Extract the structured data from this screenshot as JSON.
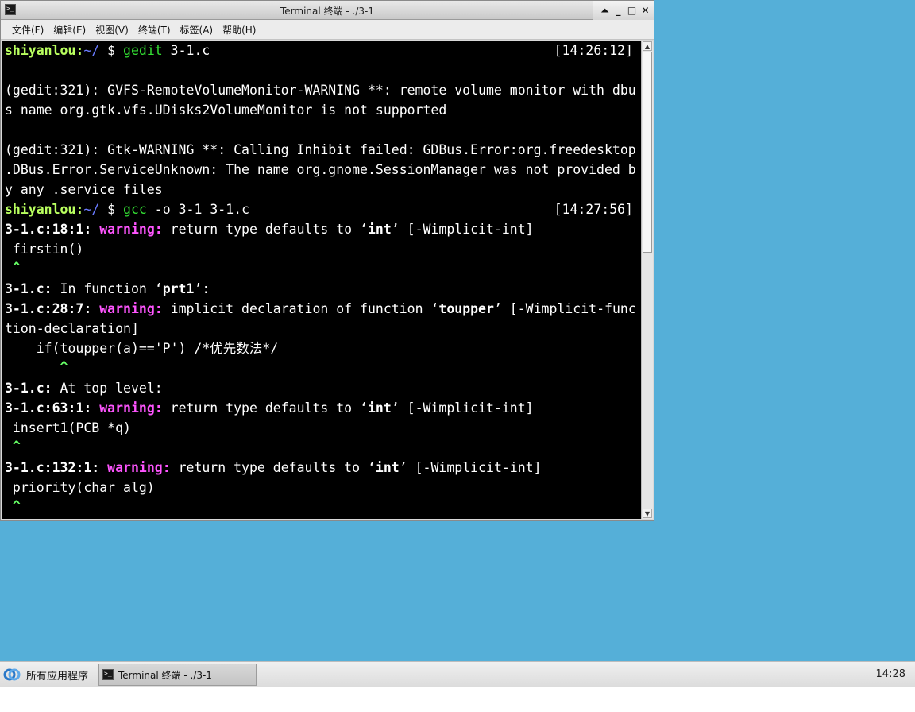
{
  "window": {
    "title": "Terminal 终端 - ./3-1",
    "controls": {
      "shade": "⏶",
      "minimize": "_",
      "maximize": "□",
      "close": "✕"
    }
  },
  "menu": {
    "items": [
      "文件(F)",
      "编辑(E)",
      "视图(V)",
      "终端(T)",
      "标签(A)",
      "帮助(H)"
    ]
  },
  "terminal": {
    "prompt_user": "shiyanlou",
    "prompt_sep": ":",
    "prompt_path": "~/",
    "prompt_dollar": " $ ",
    "cmd1_program": "gedit",
    "cmd1_args": " 3-1.c",
    "cmd1_time": "[14:26:12]",
    "gvfs_line1": "(gedit:321): GVFS-RemoteVolumeMonitor-WARNING **: remote volume monitor with dbu",
    "gvfs_line2": "s name org.gtk.vfs.UDisks2VolumeMonitor is not supported",
    "gtk_line1": "(gedit:321): Gtk-WARNING **: Calling Inhibit failed: GDBus.Error:org.freedesktop",
    "gtk_line2": ".DBus.Error.ServiceUnknown: The name org.gnome.SessionManager was not provided b",
    "gtk_line3": "y any .service files",
    "cmd2_program": "gcc",
    "cmd2_args": " -o 3-1 ",
    "cmd2_file": "3-1.c",
    "cmd2_time": "[14:27:56]",
    "warning_word": "warning:",
    "loc_18": "3-1.c:18:1:",
    "msg_return_type": " return type defaults to ‘",
    "int_word": "int",
    "implicit_int_flag": "’ [-Wimplicit-int]",
    "code_firstin": " firstin()",
    "caret_1": " ^",
    "in_function_file": "3-1.c:",
    "in_function_text": " In function ‘",
    "fn_prt1": "prt1",
    "in_function_end": "’:",
    "loc_28": "3-1.c:28:7:",
    "msg_implicit_decl": " implicit declaration of function ‘",
    "fn_toupper": "toupper",
    "implicit_decl_flag": "’ [-Wimplicit-func",
    "implicit_decl_flag2": "tion-declaration]",
    "code_if": "    if(toupper(a)=='P') /*优先数法*/",
    "caret_2": "       ^",
    "top_level_file": "3-1.c:",
    "top_level_text": " At top level:",
    "loc_63": "3-1.c:63:1:",
    "code_insert": " insert1(PCB *q)",
    "caret_3": " ^",
    "loc_132": "3-1.c:132:1:",
    "code_priority": " priority(char alg)",
    "caret_4": " ^"
  },
  "taskbar": {
    "apps_label": "所有应用程序",
    "task_label": "Terminal 终端 - ./3-1",
    "clock": "14:28"
  },
  "colors": {
    "desktop": "#55afd8",
    "terminal_bg": "#000000",
    "prompt_user": "#b9ff5f",
    "prompt_path": "#6a7bff",
    "command": "#33dd33",
    "warning": "#ff55ff"
  }
}
